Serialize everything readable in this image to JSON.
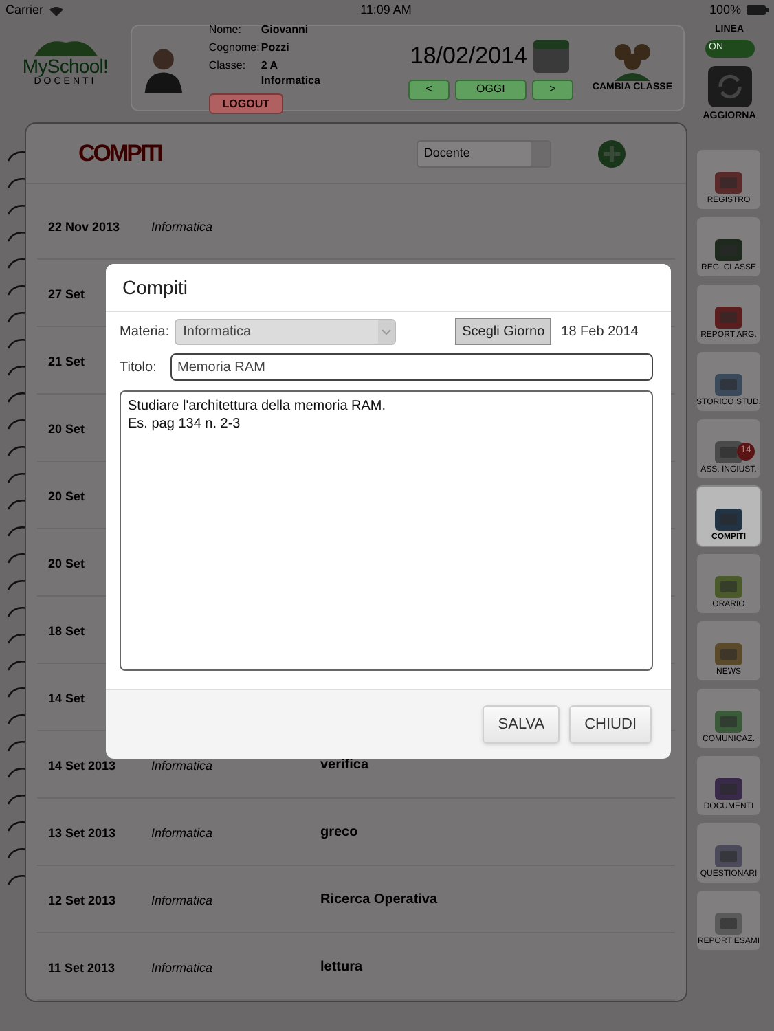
{
  "status_bar": {
    "carrier": "Carrier",
    "time": "11:09 AM",
    "battery": "100%"
  },
  "header": {
    "logo": {
      "title": "MySchool!",
      "subtitle": "DOCENTI"
    },
    "user": [
      {
        "label": "Nome:",
        "value": "Giovanni"
      },
      {
        "label": "Cognome:",
        "value": "Pozzi"
      },
      {
        "label": "Classe:",
        "value": "2 A Informatica"
      }
    ],
    "logout": "LOGOUT",
    "date": "18/02/2014",
    "nav": [
      "<",
      "OGGI",
      ">"
    ],
    "change_class": "CAMBIA CLASSE",
    "online": {
      "label": "LINEA",
      "on": true,
      "text": "ON"
    },
    "refresh": "AGGIORNA"
  },
  "notebook": {
    "title": "COMPITI",
    "filter": "Docente",
    "rows": [
      {
        "date": "22 Nov 2013",
        "subject": "Informatica"
      },
      {
        "date": "27 Set"
      },
      {
        "date": "21 Set"
      },
      {
        "date": "20 Set"
      },
      {
        "date": "20 Set"
      },
      {
        "date": "20 Set"
      },
      {
        "date": "18 Set"
      },
      {
        "date": "14 Set"
      },
      {
        "date": "14 Set 2013",
        "subject": "Informatica",
        "title": "verifica"
      },
      {
        "date": "13 Set 2013",
        "subject": "Informatica",
        "title": "greco"
      },
      {
        "date": "12 Set 2013",
        "subject": "Informatica",
        "title": "Ricerca Operativa"
      },
      {
        "date": "11 Set 2013",
        "subject": "Informatica",
        "title": "lettura"
      }
    ]
  },
  "sidebar": {
    "items": [
      {
        "label": "REGISTRO",
        "selected": false
      },
      {
        "label": "REG. CLASSE",
        "selected": false
      },
      {
        "label": "REPORT ARG.",
        "selected": false
      },
      {
        "label": "STORICO STUD.",
        "selected": false
      },
      {
        "label": "ASS. INGIUST.",
        "selected": false,
        "badge": "14"
      },
      {
        "label": "COMPITI",
        "selected": true
      },
      {
        "label": "ORARIO",
        "selected": false
      },
      {
        "label": "NEWS",
        "selected": false
      },
      {
        "label": "COMUNICAZ.",
        "selected": false
      },
      {
        "label": "DOCUMENTI",
        "selected": false
      },
      {
        "label": "QUESTIONARI",
        "selected": false
      },
      {
        "label": "REPORT ESAMI",
        "selected": false
      }
    ]
  },
  "dialog": {
    "title": "Compiti",
    "subject_label": "Materia:",
    "subject": "Informatica",
    "day_button": "Scegli Giorno",
    "day": "18 Feb 2014",
    "title_label": "Titolo:",
    "title_value": "Memoria RAM",
    "text": "Studiare l'architettura della memoria RAM.\nEs. pag 134 n. 2-3",
    "buttons": [
      "SALVA",
      "CHIUDI"
    ]
  }
}
